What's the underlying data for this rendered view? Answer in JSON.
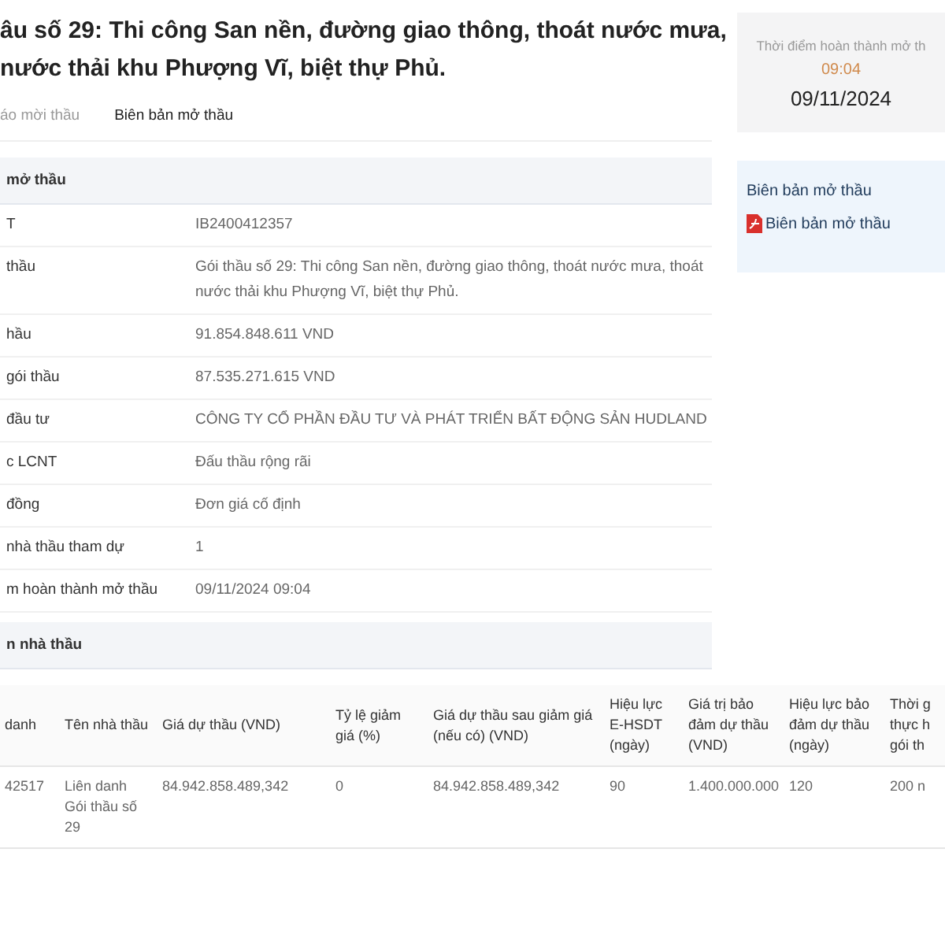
{
  "title_lines": [
    "âu số 29: Thi công San nền, đường giao thông, thoát nước mưa,",
    "nước thải khu Phượng Vĩ, biệt thự Phủ."
  ],
  "tabs": [
    {
      "label": "áo mời thầu",
      "selected": false
    },
    {
      "label": "Biên bản mở thầu",
      "selected": true
    }
  ],
  "info": {
    "heading": "mở thầu",
    "rows": [
      {
        "label": "T",
        "value": "IB2400412357"
      },
      {
        "label": "thầu",
        "value": "Gói thầu số 29: Thi công San nền, đường giao thông, thoát nước mưa, thoát nước thải khu Phượng Vĩ, biệt thự Phủ."
      },
      {
        "label": "hầu",
        "value": "91.854.848.611 VND"
      },
      {
        "label": "gói thầu",
        "value": "87.535.271.615 VND"
      },
      {
        "label": "đầu tư",
        "value": "CÔNG TY CỔ PHẦN ĐẦU TƯ VÀ PHÁT TRIỂN BẤT ĐỘNG SẢN HUDLAND"
      },
      {
        "label": "c LCNT",
        "value": "Đấu thầu rộng rãi"
      },
      {
        "label": "đồng",
        "value": "Đơn giá cố định"
      },
      {
        "label": "nhà thầu tham dự",
        "value": "1"
      },
      {
        "label": "m hoàn thành mở thầu",
        "value": "09/11/2024 09:04"
      }
    ]
  },
  "completion": {
    "caption": "Thời điểm hoàn thành mở th",
    "time": "09:04",
    "date": "09/11/2024"
  },
  "documents": {
    "heading": "Biên bản mở thầu",
    "link": "Biên bản mở thầu"
  },
  "bidders": {
    "heading": "n nhà thầu",
    "columns": [
      "danh",
      "Tên nhà thầu",
      "Giá dự thầu (VND)",
      "Tỷ lệ giảm giá (%)",
      "Giá dự thầu sau giảm giá (nếu có) (VND)",
      "Hiệu lực E-HSDT (ngày)",
      "Giá trị bảo đảm dự thầu (VND)",
      "Hiệu lực bảo đảm dự thầu (ngày)",
      "Thời g\nthực h\ngói th"
    ],
    "rows": [
      [
        "42517",
        "Liên danh Gói thầu số 29",
        "84.942.858.489,342",
        "0",
        "84.942.858.489,342",
        "90",
        "1.400.000.000",
        "120",
        "200 n"
      ]
    ]
  }
}
